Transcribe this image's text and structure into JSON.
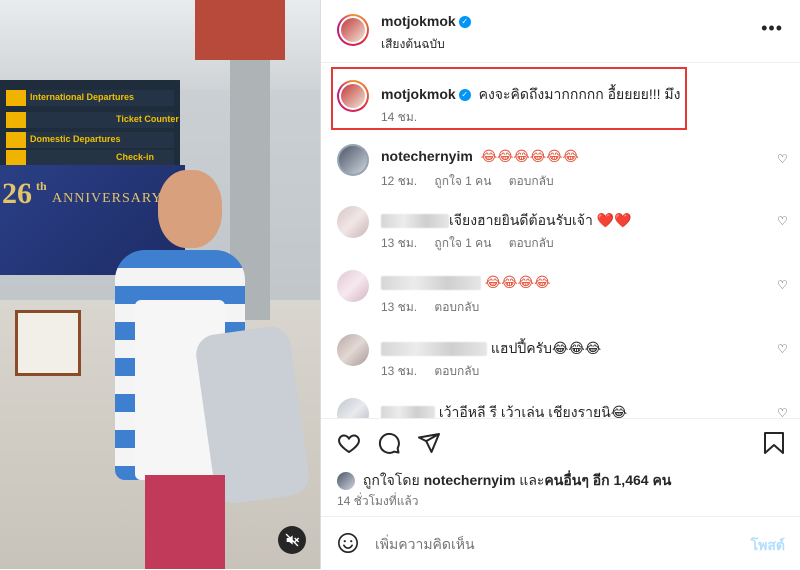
{
  "photo": {
    "sign_intl": "International Departures",
    "sign_domestic": "Domestic Departures",
    "sign_ticket": "Ticket Counter",
    "sign_checkin": "Check-in",
    "banner_number": "26",
    "banner_th": "th",
    "banner_text": "ANNIVERSARY"
  },
  "header": {
    "username": "motjokmok",
    "audio": "เสียงต้นฉบับ",
    "more": "•••"
  },
  "caption": {
    "username": "motjokmok",
    "text": "คงจะคิดถึงมากกกกก อื้ยยยย!!! มึง",
    "time": "14 ชม."
  },
  "comments": [
    {
      "username": "notechernyim",
      "text": "😂😂😂😂😂😂",
      "time": "12 ชม.",
      "likes": "ถูกใจ 1 คน",
      "reply": "ตอบกลับ"
    },
    {
      "username": "",
      "text": "เจียงฮายยินดีต้อนรับเจ้า ❤️❤️",
      "time": "13 ชม.",
      "likes": "ถูกใจ 1 คน",
      "reply": "ตอบกลับ"
    },
    {
      "username": "",
      "text": "😂😂😂😂",
      "time": "13 ชม.",
      "likes": "",
      "reply": "ตอบกลับ"
    },
    {
      "username": "",
      "text": "แฮปปี้ครับ😂😂😂",
      "time": "13 ชม.",
      "likes": "",
      "reply": "ตอบกลับ"
    },
    {
      "username": "",
      "text": "เว้าอีหลี รี เว้าเล่น เชียงรายนิ😂",
      "time": "",
      "likes": "",
      "reply": ""
    }
  ],
  "likes": {
    "prefix": "ถูกใจโดย",
    "user": "notechernyim",
    "and": "และ",
    "others": "คนอื่นๆ อีก 1,464 คน"
  },
  "posted": "14 ชั่วโมงที่แล้ว",
  "comment_input": {
    "placeholder": "เพิ่มความคิดเห็น",
    "post": "โพสต์"
  },
  "colors": {
    "accent_blue": "#0095f6",
    "highlight_border": "#e53935"
  }
}
